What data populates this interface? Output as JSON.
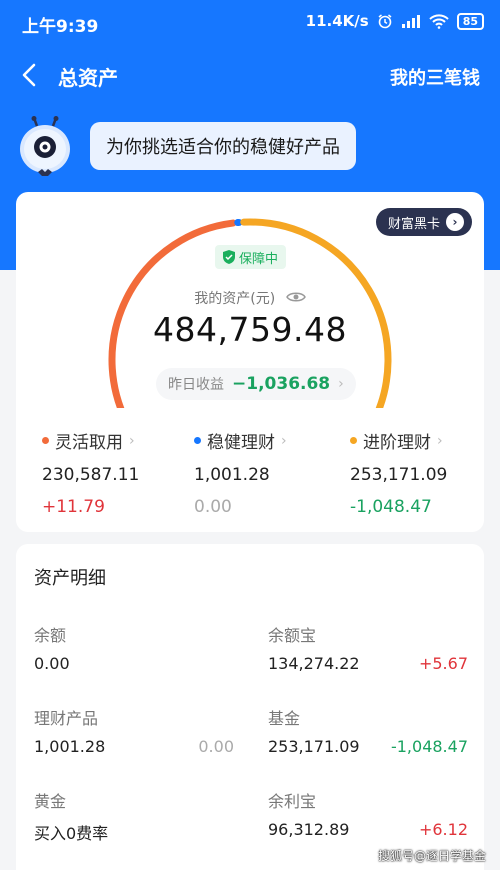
{
  "status_bar": {
    "time": "上午9:39",
    "speed": "11.4K/s",
    "battery": "85"
  },
  "nav": {
    "title": "总资产",
    "right_link": "我的三笔钱"
  },
  "bubble": {
    "text": "为你挑选适合你的稳健好产品"
  },
  "summary": {
    "black_card_label": "财富黑卡",
    "protect_label": "保障中",
    "asset_label": "我的资产(元)",
    "asset_value": "484,759.48",
    "yesterday_label": "昨日收益",
    "yesterday_value": "−1,036.68",
    "gauge_shares": [
      {
        "name": "灵活取用",
        "value": 230587.11,
        "color": "#f26b3a"
      },
      {
        "name": "稳健理财",
        "value": 1001.28,
        "color": "#1677ff"
      },
      {
        "name": "进阶理财",
        "value": 253171.09,
        "color": "#f5a623"
      }
    ]
  },
  "categories": [
    {
      "label": "灵活取用",
      "amount": "230,587.11",
      "change": "+11.79",
      "color": "#f26b3a",
      "change_color": "red"
    },
    {
      "label": "稳健理财",
      "amount": "1,001.28",
      "change": "0.00",
      "color": "#1677ff",
      "change_color": "grey"
    },
    {
      "label": "进阶理财",
      "amount": "253,171.09",
      "change": "-1,048.47",
      "color": "#f5a623",
      "change_color": "green"
    }
  ],
  "details": {
    "title": "资产明细",
    "rows": [
      [
        {
          "name": "余额",
          "amount": "0.00",
          "change": ""
        },
        {
          "name": "余额宝",
          "amount": "134,274.22",
          "change": "+5.67",
          "change_color": "red"
        }
      ],
      [
        {
          "name": "理财产品",
          "amount": "1,001.28",
          "change": "0.00",
          "change_color": "grey"
        },
        {
          "name": "基金",
          "amount": "253,171.09",
          "change": "-1,048.47",
          "change_color": "green"
        }
      ],
      [
        {
          "name": "黄金",
          "amount": "买入0费率",
          "change": ""
        },
        {
          "name": "余利宝",
          "amount": "96,312.89",
          "change": "+6.12",
          "change_color": "red"
        }
      ]
    ]
  },
  "watermark": "搜狐号@逐日学基金",
  "colors": {
    "brand_blue": "#1677ff",
    "gain_red": "#e0343a",
    "loss_green": "#1aa260"
  }
}
